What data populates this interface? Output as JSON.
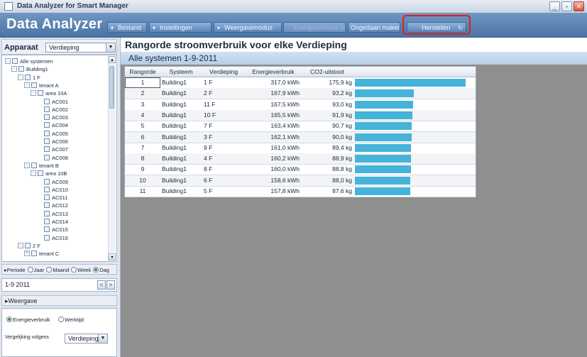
{
  "window": {
    "title": "Data Analyzer for Smart Manager",
    "minimize_icon": "minimize-icon",
    "maximize_icon": "maximize-icon",
    "close_icon": "close-icon"
  },
  "header": {
    "brand": "Data Analyzer",
    "menu": {
      "bestand": "Bestand",
      "instellingen": "Instellingen",
      "weergavemodus": "Weergavemodus",
      "disabled": "Energieverbruik opslaan",
      "undo": "Ongedaan maken",
      "herstellen": "Herstellen"
    }
  },
  "left": {
    "apparaat_label": "Apparaat",
    "apparaat_select": "Verdieping",
    "tree": [
      {
        "label": "Alle systemen",
        "level": 0,
        "exp": "-"
      },
      {
        "label": "Building1",
        "level": 1,
        "exp": "-"
      },
      {
        "label": "1 F",
        "level": 2,
        "exp": "-"
      },
      {
        "label": "tenant A",
        "level": 3,
        "exp": "-"
      },
      {
        "label": "area 10A",
        "level": 4,
        "exp": "-"
      },
      {
        "label": "AC001",
        "level": 5
      },
      {
        "label": "AC002",
        "level": 5
      },
      {
        "label": "AC003",
        "level": 5
      },
      {
        "label": "AC004",
        "level": 5
      },
      {
        "label": "AC005",
        "level": 5
      },
      {
        "label": "AC006",
        "level": 5
      },
      {
        "label": "AC007",
        "level": 5
      },
      {
        "label": "AC008",
        "level": 5
      },
      {
        "label": "tenant B",
        "level": 3,
        "exp": "-"
      },
      {
        "label": "area 10B",
        "level": 4,
        "exp": "-"
      },
      {
        "label": "AC009",
        "level": 5
      },
      {
        "label": "AC010",
        "level": 5
      },
      {
        "label": "AC011",
        "level": 5
      },
      {
        "label": "AC012",
        "level": 5
      },
      {
        "label": "AC013",
        "level": 5
      },
      {
        "label": "AC014",
        "level": 5
      },
      {
        "label": "AC015",
        "level": 5
      },
      {
        "label": "AC016",
        "level": 5
      },
      {
        "label": "2 F",
        "level": 2,
        "exp": "-"
      },
      {
        "label": "tenant C",
        "level": 3,
        "exp": "+"
      }
    ],
    "periode": {
      "label": "Periode",
      "options": [
        "Jaar",
        "Maand",
        "Week",
        "Dag"
      ],
      "selected": "Dag"
    },
    "date": "1-9 2011",
    "weergave_label": "Weergave",
    "weergave_options": {
      "energie": "Energieverbruik",
      "werktijd": "Werktijd",
      "selected": "Energieverbruik"
    },
    "vergelijking_label": "Vergelijking volgens",
    "vergelijking_select": "Verdieping"
  },
  "main": {
    "title": "Rangorde stroomverbruik voor elke Verdieping",
    "subtitle": "Alle systemen  1-9-2011",
    "columns": [
      "Rangorde",
      "Systeem",
      "Verdieping",
      "Energieverbruik",
      "CO2-uitstoot"
    ],
    "rows": [
      {
        "rank": "1",
        "systeem": "Building1",
        "verdieping": "1 F",
        "energie": "317,0 kWh",
        "co2": "175,9 kg",
        "value": 317.0
      },
      {
        "rank": "2",
        "systeem": "Building1",
        "verdieping": "2 F",
        "energie": "167,9 kWh",
        "co2": "93,2 kg",
        "value": 167.9
      },
      {
        "rank": "3",
        "systeem": "Building1",
        "verdieping": "11 F",
        "energie": "167,5 kWh",
        "co2": "93,0 kg",
        "value": 167.5
      },
      {
        "rank": "4",
        "systeem": "Building1",
        "verdieping": "10 F",
        "energie": "165,5 kWh",
        "co2": "91,9 kg",
        "value": 165.5
      },
      {
        "rank": "5",
        "systeem": "Building1",
        "verdieping": "7 F",
        "energie": "163,4 kWh",
        "co2": "90,7 kg",
        "value": 163.4
      },
      {
        "rank": "6",
        "systeem": "Building1",
        "verdieping": "3 F",
        "energie": "162,1 kWh",
        "co2": "90,0 kg",
        "value": 162.1
      },
      {
        "rank": "7",
        "systeem": "Building1",
        "verdieping": "9 F",
        "energie": "161,0 kWh",
        "co2": "89,4 kg",
        "value": 161.0
      },
      {
        "rank": "8",
        "systeem": "Building1",
        "verdieping": "4 F",
        "energie": "160,2 kWh",
        "co2": "88,9 kg",
        "value": 160.2
      },
      {
        "rank": "9",
        "systeem": "Building1",
        "verdieping": "8 F",
        "energie": "160,0 kWh",
        "co2": "88,8 kg",
        "value": 160.0
      },
      {
        "rank": "10",
        "systeem": "Building1",
        "verdieping": "6 F",
        "energie": "158,6 kWh",
        "co2": "88,0 kg",
        "value": 158.6
      },
      {
        "rank": "11",
        "systeem": "Building1",
        "verdieping": "5 F",
        "energie": "157,8 kWh",
        "co2": "87,6 kg",
        "value": 157.8
      }
    ],
    "bar_color": "#45b3da"
  }
}
